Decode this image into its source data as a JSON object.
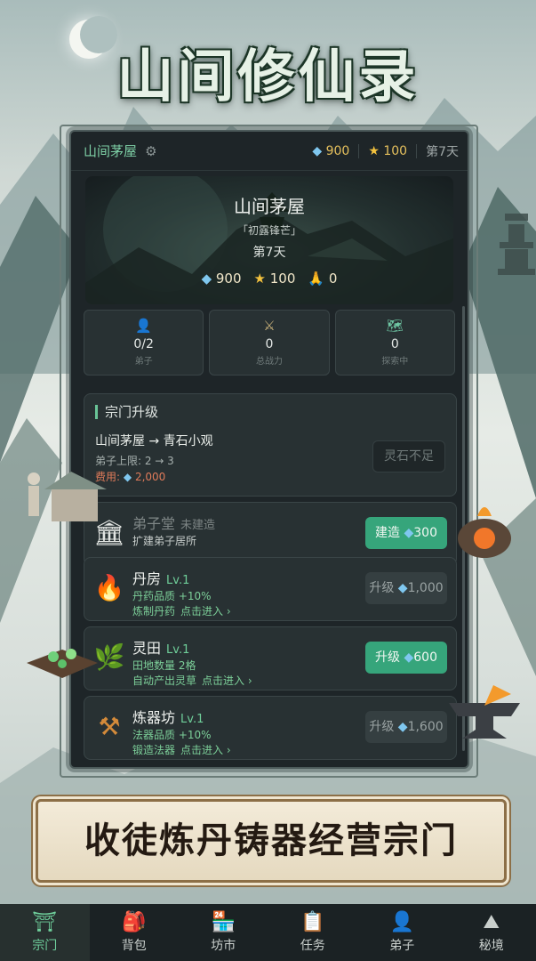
{
  "app": {
    "title": "山间修仙录"
  },
  "topbar": {
    "sect_name": "山间茅屋",
    "gems": "900",
    "stars": "100",
    "day": "第7天"
  },
  "hero": {
    "title": "山间茅屋",
    "subtitle": "「初露锋芒」",
    "day": "第7天",
    "gems": "900",
    "stars": "100",
    "prayers": "0"
  },
  "stats": [
    {
      "icon": "disciple-icon",
      "value": "0/2",
      "label": "弟子"
    },
    {
      "icon": "swords-icon",
      "value": "0",
      "label": "总战力"
    },
    {
      "icon": "map-icon",
      "value": "0",
      "label": "探索中"
    }
  ],
  "upgrade": {
    "header": "宗门升级",
    "path": "山间茅屋 → 青石小观",
    "detail": "弟子上限: 2 → 3",
    "cost_label": "费用:",
    "cost_value": "2,000",
    "button": "灵石不足"
  },
  "buildings": [
    {
      "icon": "temple-icon",
      "name": "弟子堂",
      "level": "未建造",
      "desc1": "扩建弟子居所",
      "desc2": "",
      "enter": "",
      "button": "建造",
      "cost": "300",
      "button_style": "green"
    },
    {
      "icon": "fire-icon",
      "name": "丹房",
      "level": "Lv.1",
      "desc1": "丹药品质 +10%",
      "desc2": "炼制丹药",
      "enter": "点击进入 ›",
      "button": "升级",
      "cost": "1,000",
      "button_style": "gray"
    },
    {
      "icon": "herb-icon",
      "name": "灵田",
      "level": "Lv.1",
      "desc1": "田地数量 2格",
      "desc2": "自动产出灵草",
      "enter": "点击进入 ›",
      "button": "升级",
      "cost": "600",
      "button_style": "green"
    },
    {
      "icon": "hammer-icon",
      "name": "炼器坊",
      "level": "Lv.1",
      "desc1": "法器品质 +10%",
      "desc2": "锻造法器",
      "enter": "点击进入 ›",
      "button": "升级",
      "cost": "1,600",
      "button_style": "gray"
    }
  ],
  "banner": {
    "text": "收徒炼丹铸器经营宗门"
  },
  "nav": [
    {
      "icon": "sect-icon",
      "label": "宗门",
      "active": true
    },
    {
      "icon": "backpack-icon",
      "label": "背包",
      "active": false
    },
    {
      "icon": "market-icon",
      "label": "坊市",
      "active": false
    },
    {
      "icon": "task-icon",
      "label": "任务",
      "active": false
    },
    {
      "icon": "disciple-icon",
      "label": "弟子",
      "active": false
    },
    {
      "icon": "mountain-icon",
      "label": "秘境",
      "active": false
    }
  ],
  "colors": {
    "accent": "#36a57b",
    "panel": "#1e2528",
    "gem": "#7fc7ef",
    "star": "#f3c23e",
    "warning": "#e07b5a"
  }
}
